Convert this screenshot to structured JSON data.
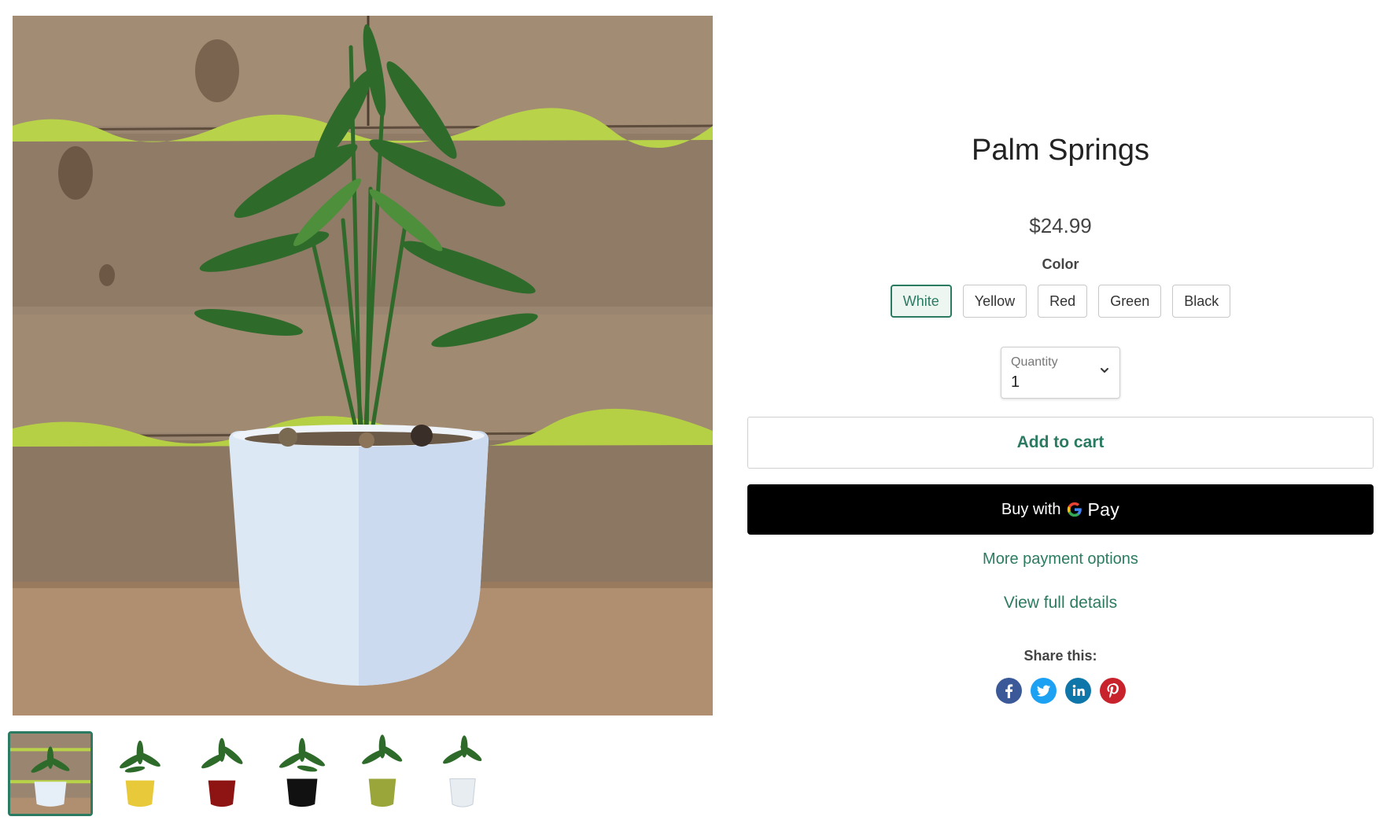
{
  "product": {
    "title": "Palm Springs",
    "price": "$24.99"
  },
  "options": {
    "color_label": "Color",
    "selected_color": "White",
    "colors": [
      "White",
      "Yellow",
      "Red",
      "Green",
      "Black"
    ]
  },
  "quantity": {
    "label": "Quantity",
    "value": "1",
    "icon": "chevron-down-icon"
  },
  "buttons": {
    "add_to_cart": "Add to cart",
    "buy_with_prefix": "Buy with",
    "buy_with_brand": "Pay",
    "more_payment_options": "More payment options",
    "view_full_details": "View full details"
  },
  "share": {
    "label": "Share this:",
    "networks": [
      {
        "name": "facebook",
        "icon": "facebook-icon",
        "color": "#3b5998"
      },
      {
        "name": "twitter",
        "icon": "twitter-icon",
        "color": "#1da1f2"
      },
      {
        "name": "linkedin",
        "icon": "linkedin-icon",
        "color": "#0e76a8"
      },
      {
        "name": "pinterest",
        "icon": "pinterest-icon",
        "color": "#c8232c"
      }
    ]
  },
  "gallery": {
    "selected_thumbnail": 1,
    "thumbnails": [
      {
        "pot_color": "#e6eef8"
      },
      {
        "pot_color": "#e8c93a"
      },
      {
        "pot_color": "#8e1414"
      },
      {
        "pot_color": "#111111"
      },
      {
        "pot_color": "#9aa63a"
      },
      {
        "pot_color": "#e8edf2"
      }
    ]
  },
  "colors": {
    "accent": "#2b7b62",
    "gpay_bg": "#000000"
  }
}
